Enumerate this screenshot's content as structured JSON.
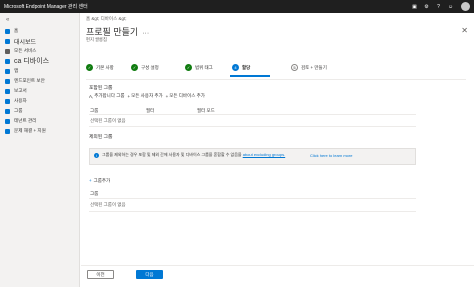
{
  "app": {
    "title": "Microsoft Endpoint Manager 관리 센터"
  },
  "topbar_icons": [
    "notification-icon",
    "settings-icon",
    "help-icon",
    "feedback-icon",
    "user-avatar"
  ],
  "sidebar": {
    "items": [
      {
        "label": "홈",
        "icon": "home-icon",
        "color": "#0078d4",
        "size": ""
      },
      {
        "label": "대시보드",
        "icon": "dashboard-icon",
        "color": "#0078d4",
        "size": "medium"
      },
      {
        "label": "모든 서비스",
        "icon": "all-services-icon",
        "color": "#605e5c",
        "size": ""
      },
      {
        "label": "ca 디바이스",
        "icon": "devices-icon",
        "color": "#0078d4",
        "size": "big"
      },
      {
        "label": "앱",
        "icon": "apps-icon",
        "color": "#0078d4",
        "size": ""
      },
      {
        "label": "엔드포인트 보안",
        "icon": "endpoint-security-icon",
        "color": "#0078d4",
        "size": ""
      },
      {
        "label": "보고서",
        "icon": "reports-icon",
        "color": "#0078d4",
        "size": ""
      },
      {
        "label": "사용자",
        "icon": "users-icon",
        "color": "#0078d4",
        "size": ""
      },
      {
        "label": "그룹",
        "icon": "groups-icon",
        "color": "#0078d4",
        "size": ""
      },
      {
        "label": "테넌트 관리",
        "icon": "tenant-admin-icon",
        "color": "#0078d4",
        "size": ""
      },
      {
        "label": "문제 해결 + 지원",
        "icon": "troubleshooting-icon",
        "color": "#0078d4",
        "size": ""
      }
    ]
  },
  "breadcrumb": "홈 &gt;    디바이스 &gt;",
  "header": {
    "title": "프로필 만들기",
    "more": "···",
    "subtitle": "편지 쌀롱칩"
  },
  "steps": [
    {
      "num": "✓",
      "label": "기본 사항",
      "state": "done"
    },
    {
      "num": "✓",
      "label": "구성 설정",
      "state": "done"
    },
    {
      "num": "✓",
      "label": "범위 태그",
      "state": "done"
    },
    {
      "num": "4",
      "label": "할당",
      "state": "current"
    },
    {
      "num": "5",
      "label": "검토 + 만들기",
      "state": "todo"
    }
  ],
  "included": {
    "title": "포함된 그룹",
    "actions": [
      {
        "prefix": "A,",
        "label": "추가합니다 그룹"
      },
      {
        "prefix": "+",
        "label": "모든 사용자 추가"
      },
      {
        "prefix": "+",
        "label": "모든 디바이스 추가"
      }
    ],
    "columns": [
      "그룹",
      "필터",
      "필터 모드"
    ],
    "empty": "선택된 그룹이 없음"
  },
  "excluded": {
    "title": "제외된 그룹",
    "info_text": "그룹을 제외하는 경우 포함 및 제외 간에 사용자 및 디바이스 그룹을 혼합할 수 없음을",
    "info_link_text": "about excluding groups.",
    "info_link": "Click here to learn more",
    "add": "그룹추가",
    "column": "그룹",
    "empty": "선택된 그룹이 없음"
  },
  "footer": {
    "prev": "이전",
    "next": "다음"
  },
  "colors": {
    "accent": "#0078d4",
    "success": "#107c10",
    "topbar": "#1f1f1f"
  }
}
